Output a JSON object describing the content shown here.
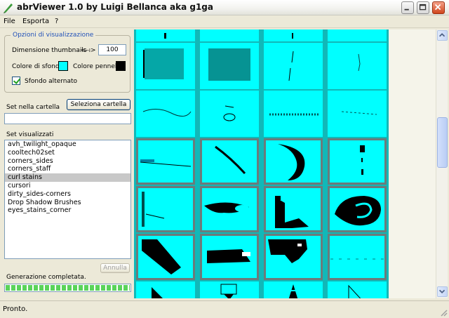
{
  "window": {
    "title": "abrViewer 1.0 by Luigi Bellanca aka g1ga"
  },
  "menu": {
    "items": [
      "File",
      "Esporta",
      "?"
    ]
  },
  "options": {
    "legend": "Opzioni di visualizzazione",
    "thumb_label": "Dimensione thumbnails :",
    "thumb_arrows": "<-->",
    "thumb_value": "100",
    "bg_label": "Colore di sfondo:",
    "bg_color": "#00ffff",
    "brush_label": "Colore pennelli:",
    "brush_color": "#000000",
    "alt_bg_label": "Sfondo alternato",
    "alt_bg_checked": true
  },
  "folder": {
    "label": "Set nella cartella",
    "button": "Seleziona cartella",
    "value": ""
  },
  "sets": {
    "label": "Set visualizzati",
    "items": [
      "avh_twilight_opaque",
      "cooltech02set",
      "corners_sides",
      "corners_staff",
      "curl stains",
      "cursori",
      "dirty_sides-corners",
      "Drop Shadow Brushes",
      "eyes_stains_corner"
    ],
    "selected_index": 4,
    "cancel_button": "Annulla"
  },
  "generation": {
    "label": "Generazione completata.",
    "progress": 1.0
  },
  "thumbnails": {
    "background_color": "#00ffff",
    "frame_color": "#6b7b7b",
    "columns": 4
  },
  "status": {
    "text": "Pronto."
  }
}
